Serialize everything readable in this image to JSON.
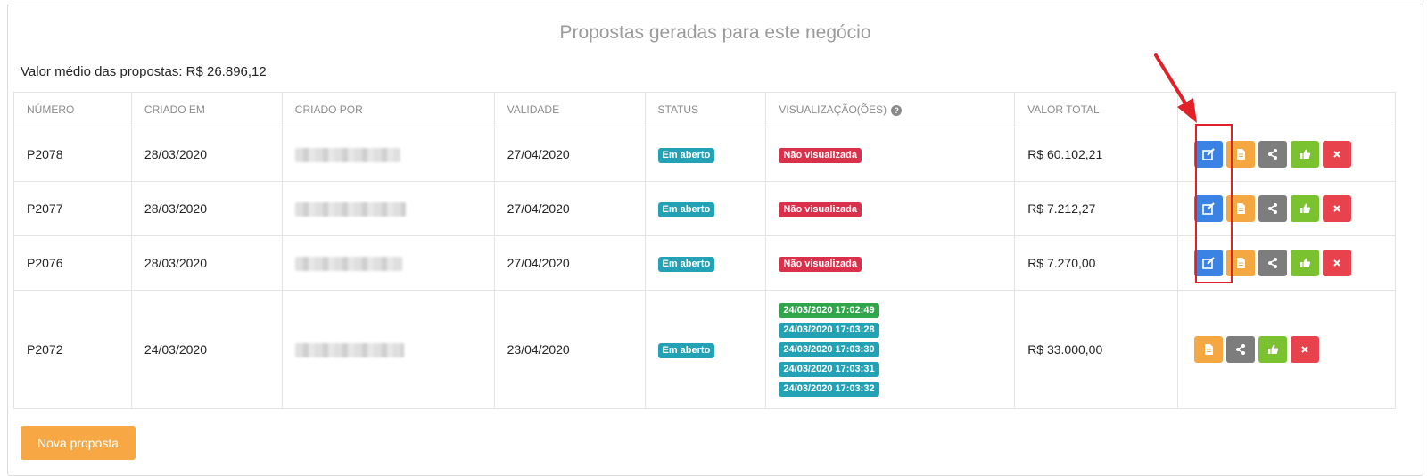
{
  "panel": {
    "title": "Propostas geradas para este negócio",
    "average_label": "Valor médio das propostas: R$ 26.896,12"
  },
  "table": {
    "headers": {
      "numero": "NÚMERO",
      "criado_em": "CRIADO EM",
      "criado_por": "CRIADO POR",
      "validade": "VALIDADE",
      "status": "STATUS",
      "visualizacoes": "VISUALIZAÇÃO(ÕES)",
      "valor_total": "VALOR TOTAL"
    },
    "rows": [
      {
        "numero": "P2078",
        "criado_em": "28/03/2020",
        "validade": "27/04/2020",
        "status": "Em aberto",
        "visualizacao": "Não visualizada",
        "valor_total": "R$ 60.102,21"
      },
      {
        "numero": "P2077",
        "criado_em": "28/03/2020",
        "validade": "27/04/2020",
        "status": "Em aberto",
        "visualizacao": "Não visualizada",
        "valor_total": "R$ 7.212,27"
      },
      {
        "numero": "P2076",
        "criado_em": "28/03/2020",
        "validade": "27/04/2020",
        "status": "Em aberto",
        "visualizacao": "Não visualizada",
        "valor_total": "R$ 7.270,00"
      },
      {
        "numero": "P2072",
        "criado_em": "24/03/2020",
        "validade": "23/04/2020",
        "status": "Em aberto",
        "views": [
          "24/03/2020 17:02:49",
          "24/03/2020 17:03:28",
          "24/03/2020 17:03:30",
          "24/03/2020 17:03:31",
          "24/03/2020 17:03:32"
        ],
        "valor_total": "R$ 33.000,00"
      }
    ]
  },
  "footer": {
    "new_button_label": "Nova proposta"
  },
  "icons": {
    "edit": "edit-icon",
    "document": "document-icon",
    "share": "share-icon",
    "approve": "thumbs-up-icon",
    "delete": "close-icon",
    "help": "question-circle-icon"
  },
  "colors": {
    "edit": "#3a82e4",
    "document": "#f5a742",
    "share": "#7d7d7d",
    "approve": "#7ac230",
    "delete": "#e8424d",
    "status_teal": "#23a2b6",
    "not_viewed_red": "#d9304b",
    "first_view_green": "#2fa64a",
    "annotation_red": "#e22028",
    "new_button": "#f7a845"
  }
}
